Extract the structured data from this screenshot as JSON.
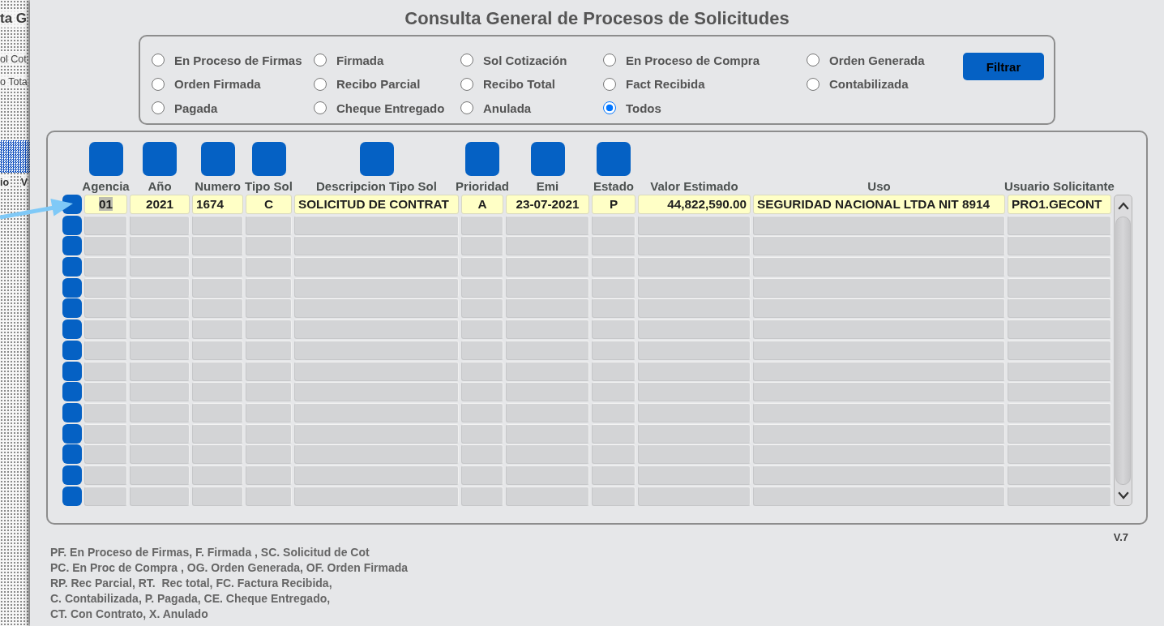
{
  "background_window": {
    "title": "ta G",
    "labels": [
      "ol Cot",
      "o Tota"
    ],
    "column_headers": [
      "io",
      "V"
    ]
  },
  "window": {
    "title": "Consulta General de Procesos de Solicitudes"
  },
  "filter": {
    "options": [
      {
        "label": "En Proceso de Firmas",
        "selected": false
      },
      {
        "label": "Firmada",
        "selected": false
      },
      {
        "label": "Sol Cotización",
        "selected": false
      },
      {
        "label": "En Proceso de Compra",
        "selected": false
      },
      {
        "label": "Orden Generada",
        "selected": false
      },
      {
        "label": "Orden Firmada",
        "selected": false
      },
      {
        "label": "Recibo Parcial",
        "selected": false
      },
      {
        "label": "Recibo Total",
        "selected": false
      },
      {
        "label": "Fact Recibida",
        "selected": false
      },
      {
        "label": "Contabilizada",
        "selected": false
      },
      {
        "label": "Pagada",
        "selected": false
      },
      {
        "label": "Cheque Entregado",
        "selected": false
      },
      {
        "label": "Anulada",
        "selected": false
      },
      {
        "label": "Todos",
        "selected": true
      }
    ],
    "button": "Filtrar"
  },
  "table": {
    "columns": [
      {
        "label": "Agencia",
        "has_button": true
      },
      {
        "label": "Año",
        "has_button": true
      },
      {
        "label": "Numero",
        "has_button": true
      },
      {
        "label": "Tipo Sol",
        "has_button": true
      },
      {
        "label": "Descripcion Tipo Sol",
        "has_button": true
      },
      {
        "label": "Prioridad",
        "has_button": true
      },
      {
        "label": "Emi",
        "has_button": true
      },
      {
        "label": "Estado",
        "has_button": true
      },
      {
        "label": "Valor Estimado",
        "has_button": false
      },
      {
        "label": "Uso",
        "has_button": false
      },
      {
        "label": "Usuario Solicitante",
        "has_button": false
      }
    ],
    "rows": [
      {
        "filled": true,
        "cells": [
          {
            "text": "01",
            "highlighted": true
          },
          {
            "text": "2021",
            "highlighted": false
          },
          {
            "text": "1674",
            "highlighted": false
          },
          {
            "text": "C",
            "highlighted": false
          },
          {
            "text": "SOLICITUD DE CONTRAT",
            "highlighted": false
          },
          {
            "text": "A",
            "highlighted": false
          },
          {
            "text": "23-07-2021",
            "highlighted": false
          },
          {
            "text": "P",
            "highlighted": false
          },
          {
            "text": "44,822,590.00",
            "highlighted": false
          },
          {
            "text": "SEGURIDAD NACIONAL LTDA NIT 8914",
            "highlighted": false
          },
          {
            "text": "PRO1.GECONT",
            "highlighted": false
          }
        ]
      },
      {
        "filled": false
      },
      {
        "filled": false
      },
      {
        "filled": false
      },
      {
        "filled": false
      },
      {
        "filled": false
      },
      {
        "filled": false
      },
      {
        "filled": false
      },
      {
        "filled": false
      },
      {
        "filled": false
      },
      {
        "filled": false
      },
      {
        "filled": false
      },
      {
        "filled": false
      },
      {
        "filled": false
      },
      {
        "filled": false
      }
    ]
  },
  "version": "V.7",
  "legend": [
    "PF. En Proceso de Firmas, F. Firmada , SC. Solicitud de Cot",
    "PC. En Proc de Compra , OG. Orden Generada, OF. Orden Firmada",
    "RP. Rec Parcial, RT.  Rec total, FC. Factura Recibida,",
    "C. Contabilizada, P. Pagada, CE. Cheque Entregado,",
    "CT. Con Contrato, X. Anulado"
  ]
}
